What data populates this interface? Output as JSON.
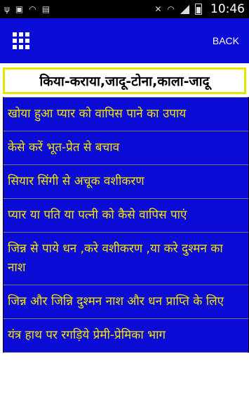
{
  "status_bar": {
    "time": "10:46",
    "icons_left": [
      "usb-icon",
      "image-icon",
      "wifi-icon",
      "sd-card-icon"
    ],
    "icons_right": [
      "mute-icon",
      "wifi-icon",
      "signal-icon",
      "battery-icon"
    ]
  },
  "app_bar": {
    "menu_icon": "grid-menu-icon",
    "back_label": "BACK",
    "background": "#0b0bd6"
  },
  "title": "किया-कराया,जादू-टोना,काला-जादू",
  "list": {
    "text_color": "#f2e600",
    "items": [
      {
        "label": "खोया हुआ प्यार को वापिस पाने का उपाय"
      },
      {
        "label": "केसे करें भूत-प्रेत से बचाव"
      },
      {
        "label": "सियार सिंगी से अचूक वशीकरण"
      },
      {
        "label": "प्यार या पति या पत्नी को कैसे वापिस पाएं"
      },
      {
        "label": "जिन्न से पाये धन ,करे वशीकरण ,या करे दुश्मन का नाश"
      },
      {
        "label": "जिन्न और जिन्नि दुश्मन नाश और धन प्राप्ति के लिए"
      },
      {
        "label": "यंत्र हाथ पर रगड़िये प्रेमी-प्रेमिका भाग"
      }
    ]
  }
}
